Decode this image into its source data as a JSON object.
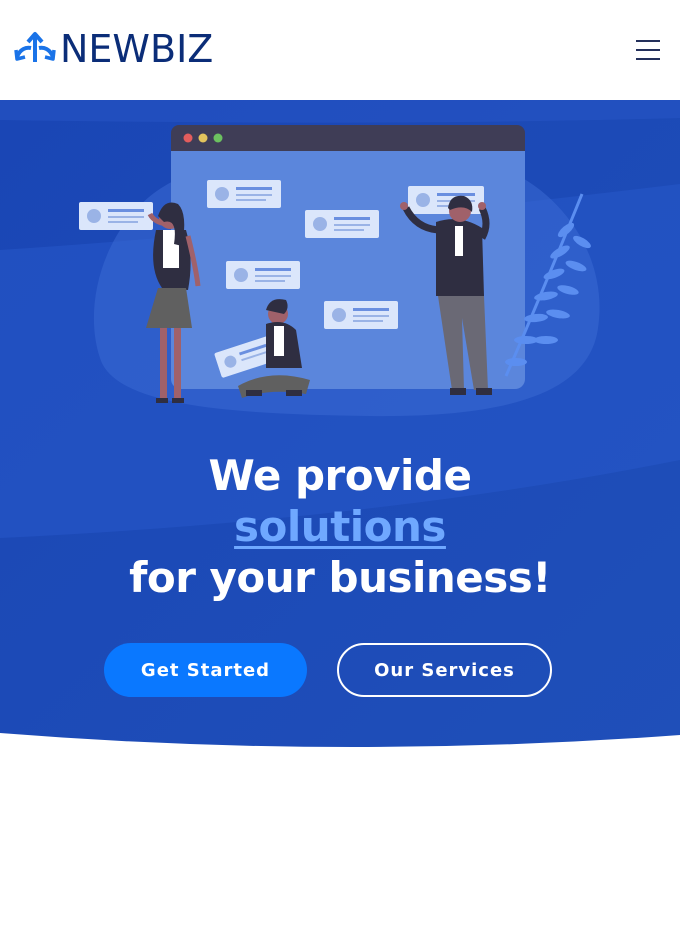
{
  "brand": {
    "name": "NEWBIZ",
    "icon": "arrows-split-icon",
    "text_color": "#0b2d78",
    "icon_color": "#1a73e8"
  },
  "nav": {
    "menu_icon": "hamburger-icon"
  },
  "hero": {
    "headline_line1": "We provide",
    "headline_highlight": "solutions",
    "headline_line3": "for your business!",
    "background_color": "#1c4bb8",
    "highlight_color": "#6fa8ff",
    "illustration": "team-collaboration-illustration"
  },
  "actions": {
    "get_started_label": "Get Started",
    "our_services_label": "Our Services",
    "primary_color": "#0a78ff"
  }
}
